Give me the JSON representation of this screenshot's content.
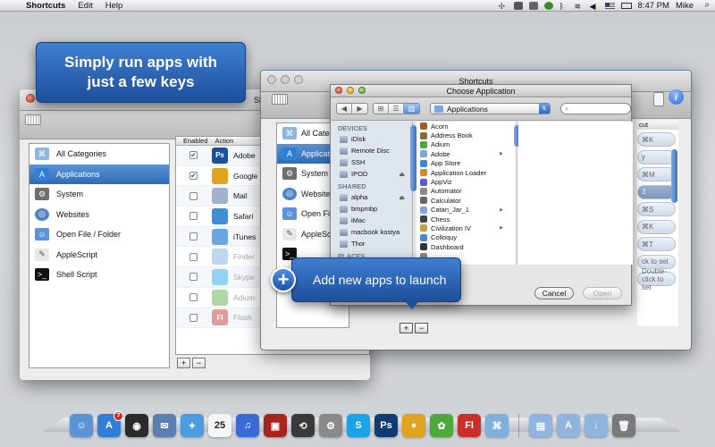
{
  "menubar": {
    "app_name": "Shortcuts",
    "menus": [
      "Edit",
      "Help"
    ],
    "time": "8:47 PM",
    "user": "Mike"
  },
  "callouts": {
    "top_line1": "Simply run apps with",
    "top_line2": "just a few keys",
    "bottom": "Add new apps to launch"
  },
  "back_window": {
    "title": "Sh",
    "categories": [
      {
        "label": "All Categories",
        "icon": "shortcuts-icon",
        "selected": false
      },
      {
        "label": "Applications",
        "icon": "app-store-icon",
        "selected": true
      },
      {
        "label": "System",
        "icon": "system-icon",
        "selected": false
      },
      {
        "label": "Websites",
        "icon": "globe-icon",
        "selected": false
      },
      {
        "label": "Open File / Folder",
        "icon": "finder-icon",
        "selected": false
      },
      {
        "label": "AppleScript",
        "icon": "script-icon",
        "selected": false
      },
      {
        "label": "Shell Script",
        "icon": "terminal-icon",
        "selected": false
      }
    ],
    "columns": {
      "enabled": "Enabled",
      "action": "Action"
    },
    "apps": [
      {
        "name": "Adobe",
        "checked": true,
        "color": "#1b4f9c",
        "glyph": "Ps",
        "dim": false
      },
      {
        "name": "Google",
        "checked": true,
        "color": "#e0a31e",
        "glyph": "",
        "dim": false
      },
      {
        "name": "Mail",
        "checked": false,
        "color": "#9fb3cc",
        "glyph": "",
        "dim": false
      },
      {
        "name": "Safari",
        "checked": false,
        "color": "#3f8ed8",
        "glyph": "",
        "dim": false
      },
      {
        "name": "iTunes",
        "checked": false,
        "color": "#6ba6e0",
        "glyph": "",
        "dim": false
      },
      {
        "name": "Finder",
        "checked": false,
        "color": "#6ea4dc",
        "glyph": "",
        "dim": true
      },
      {
        "name": "Skype",
        "checked": false,
        "color": "#1aa3e8",
        "glyph": "",
        "dim": true
      },
      {
        "name": "Adium",
        "checked": false,
        "color": "#4caa3a",
        "glyph": "",
        "dim": true
      },
      {
        "name": "Flash",
        "checked": false,
        "color": "#c9302c",
        "glyph": "Fl",
        "dim": true
      }
    ]
  },
  "front_window": {
    "title": "Shortcuts",
    "categories": [
      "All Categ",
      "Applicati",
      "System",
      "Website",
      "Open Fi",
      "AppleSc",
      ""
    ],
    "shortcut_head": "cut",
    "shortcuts": [
      "⌘K",
      "y",
      "⌘M",
      "3",
      "⌘S",
      "⌘K",
      "⌘T",
      "ck to set",
      "Double-click to set"
    ]
  },
  "choose_sheet": {
    "title": "Choose Application",
    "location": "Applications",
    "search_placeholder": "",
    "sidebar": {
      "devices_head": "DEVICES",
      "devices": [
        {
          "label": "iDisk",
          "eject": false
        },
        {
          "label": "Remote Disc",
          "eject": false
        },
        {
          "label": "SSH",
          "eject": false
        },
        {
          "label": "IPOD",
          "eject": true
        }
      ],
      "shared_head": "SHARED",
      "shared": [
        {
          "label": "alpha",
          "eject": true
        },
        {
          "label": "bmpmbp",
          "eject": false
        },
        {
          "label": "iMac",
          "eject": false
        },
        {
          "label": "macbook kostya",
          "eject": false
        },
        {
          "label": "Thor",
          "eject": false
        }
      ],
      "places_head": "PLACES"
    },
    "files": [
      {
        "name": "Acorn",
        "color": "#a55a2a",
        "folder": false
      },
      {
        "name": "Address Book",
        "color": "#8a6a3a",
        "folder": false
      },
      {
        "name": "Adium",
        "color": "#4caa3a",
        "folder": false
      },
      {
        "name": "Adobe",
        "color": "#7aa6dc",
        "folder": true
      },
      {
        "name": "App Store",
        "color": "#3b87d8",
        "folder": false
      },
      {
        "name": "Application Loader",
        "color": "#d18a2a",
        "folder": false
      },
      {
        "name": "AppViz",
        "color": "#5b5bd0",
        "folder": false
      },
      {
        "name": "Automator",
        "color": "#8b8b8b",
        "folder": false
      },
      {
        "name": "Calculator",
        "color": "#666666",
        "folder": false
      },
      {
        "name": "Catan_Jar_1",
        "color": "#7aa6dc",
        "folder": true
      },
      {
        "name": "Chess",
        "color": "#444444",
        "folder": false
      },
      {
        "name": "Civilization IV",
        "color": "#c4a040",
        "folder": true
      },
      {
        "name": "Colloquy",
        "color": "#4a8ad0",
        "folder": false
      },
      {
        "name": "Dashboard",
        "color": "#333333",
        "folder": false
      },
      {
        "name": "",
        "color": "#888888",
        "folder": false
      }
    ],
    "cancel": "Cancel",
    "open": "Open"
  },
  "dock": {
    "items": [
      {
        "name": "finder",
        "color": "#5b93d6",
        "glyph": "☺"
      },
      {
        "name": "app-store",
        "color": "#2f7fd8",
        "glyph": "A",
        "badge": "7"
      },
      {
        "name": "dashboard",
        "color": "#2a2a2a",
        "glyph": "◉"
      },
      {
        "name": "preview",
        "color": "#5a7fb0",
        "glyph": "✉"
      },
      {
        "name": "safari",
        "color": "#4a9be0",
        "glyph": "✦"
      },
      {
        "name": "calendar",
        "color": "#f5f5f5",
        "glyph": "25"
      },
      {
        "name": "itunes",
        "color": "#3a6ad6",
        "glyph": "♫"
      },
      {
        "name": "photo-booth",
        "color": "#a8241e",
        "glyph": "▣"
      },
      {
        "name": "time-machine",
        "color": "#3a3a3a",
        "glyph": "⟲"
      },
      {
        "name": "system-preferences",
        "color": "#8a8a8a",
        "glyph": "⚙"
      },
      {
        "name": "skype",
        "color": "#1aa3e8",
        "glyph": "S"
      },
      {
        "name": "photoshop",
        "color": "#0e3c73",
        "glyph": "Ps"
      },
      {
        "name": "chrome",
        "color": "#e0a31e",
        "glyph": "●"
      },
      {
        "name": "adium",
        "color": "#4caa3a",
        "glyph": "✿"
      },
      {
        "name": "flash",
        "color": "#c9302c",
        "glyph": "Fl"
      },
      {
        "name": "shortcuts",
        "color": "#7fb0dc",
        "glyph": "⌘"
      },
      {
        "name": "documents",
        "color": "#8fb4de",
        "glyph": "▤"
      },
      {
        "name": "applications",
        "color": "#8fb4de",
        "glyph": "A"
      },
      {
        "name": "downloads",
        "color": "#8fb4de",
        "glyph": "↓"
      },
      {
        "name": "trash",
        "color": "#7a7a7a",
        "glyph": "🗑"
      }
    ]
  }
}
